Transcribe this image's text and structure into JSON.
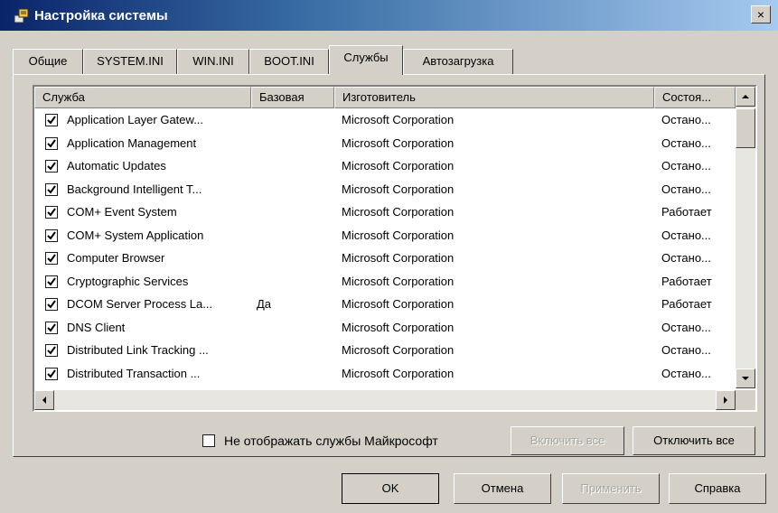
{
  "window": {
    "title": "Настройка системы",
    "close_glyph": "×"
  },
  "tabs": [
    {
      "label": "Общие"
    },
    {
      "label": "SYSTEM.INI"
    },
    {
      "label": "WIN.INI"
    },
    {
      "label": "BOOT.INI"
    },
    {
      "label": "Службы"
    },
    {
      "label": "Автозагрузка"
    }
  ],
  "active_tab": "Службы",
  "columns": [
    {
      "label": "Служба"
    },
    {
      "label": "Базовая"
    },
    {
      "label": "Изготовитель"
    },
    {
      "label": "Состоя..."
    }
  ],
  "services": [
    {
      "name": "Application Layer Gatew...",
      "essential": "",
      "manufacturer": "Microsoft Corporation",
      "status": "Остано...",
      "checked": true
    },
    {
      "name": "Application Management",
      "essential": "",
      "manufacturer": "Microsoft Corporation",
      "status": "Остано...",
      "checked": true
    },
    {
      "name": "Automatic Updates",
      "essential": "",
      "manufacturer": "Microsoft Corporation",
      "status": "Остано...",
      "checked": true
    },
    {
      "name": "Background Intelligent T...",
      "essential": "",
      "manufacturer": "Microsoft Corporation",
      "status": "Остано...",
      "checked": true
    },
    {
      "name": "COM+ Event System",
      "essential": "",
      "manufacturer": "Microsoft Corporation",
      "status": "Работает",
      "checked": true
    },
    {
      "name": "COM+ System Application",
      "essential": "",
      "manufacturer": "Microsoft Corporation",
      "status": "Остано...",
      "checked": true
    },
    {
      "name": "Computer Browser",
      "essential": "",
      "manufacturer": "Microsoft Corporation",
      "status": "Остано...",
      "checked": true
    },
    {
      "name": "Cryptographic Services",
      "essential": "",
      "manufacturer": "Microsoft Corporation",
      "status": "Работает",
      "checked": true
    },
    {
      "name": "DCOM Server Process La...",
      "essential": "Да",
      "manufacturer": "Microsoft Corporation",
      "status": "Работает",
      "checked": true
    },
    {
      "name": "DNS Client",
      "essential": "",
      "manufacturer": "Microsoft Corporation",
      "status": "Остано...",
      "checked": true
    },
    {
      "name": "Distributed Link Tracking ...",
      "essential": "",
      "manufacturer": "Microsoft Corporation",
      "status": "Остано...",
      "checked": true
    },
    {
      "name": "Distributed Transaction ...",
      "essential": "",
      "manufacturer": "Microsoft Corporation",
      "status": "Остано...",
      "checked": true
    }
  ],
  "hide_ms_services": {
    "label": "Не отображать службы Майкрософт",
    "checked": false
  },
  "buttons": {
    "enable_all": "Включить все",
    "disable_all": "Отключить все",
    "ok": "OK",
    "cancel": "Отмена",
    "apply": "Применить",
    "help": "Справка"
  },
  "colors": {
    "title_start": "#0a246a",
    "title_end": "#a6caf0",
    "face": "#d4d0c8"
  },
  "icons": [
    "system-config-icon",
    "close-icon",
    "checkbox-checked-icon",
    "scroll-up-icon",
    "scroll-down-icon",
    "scroll-left-icon",
    "scroll-right-icon"
  ]
}
